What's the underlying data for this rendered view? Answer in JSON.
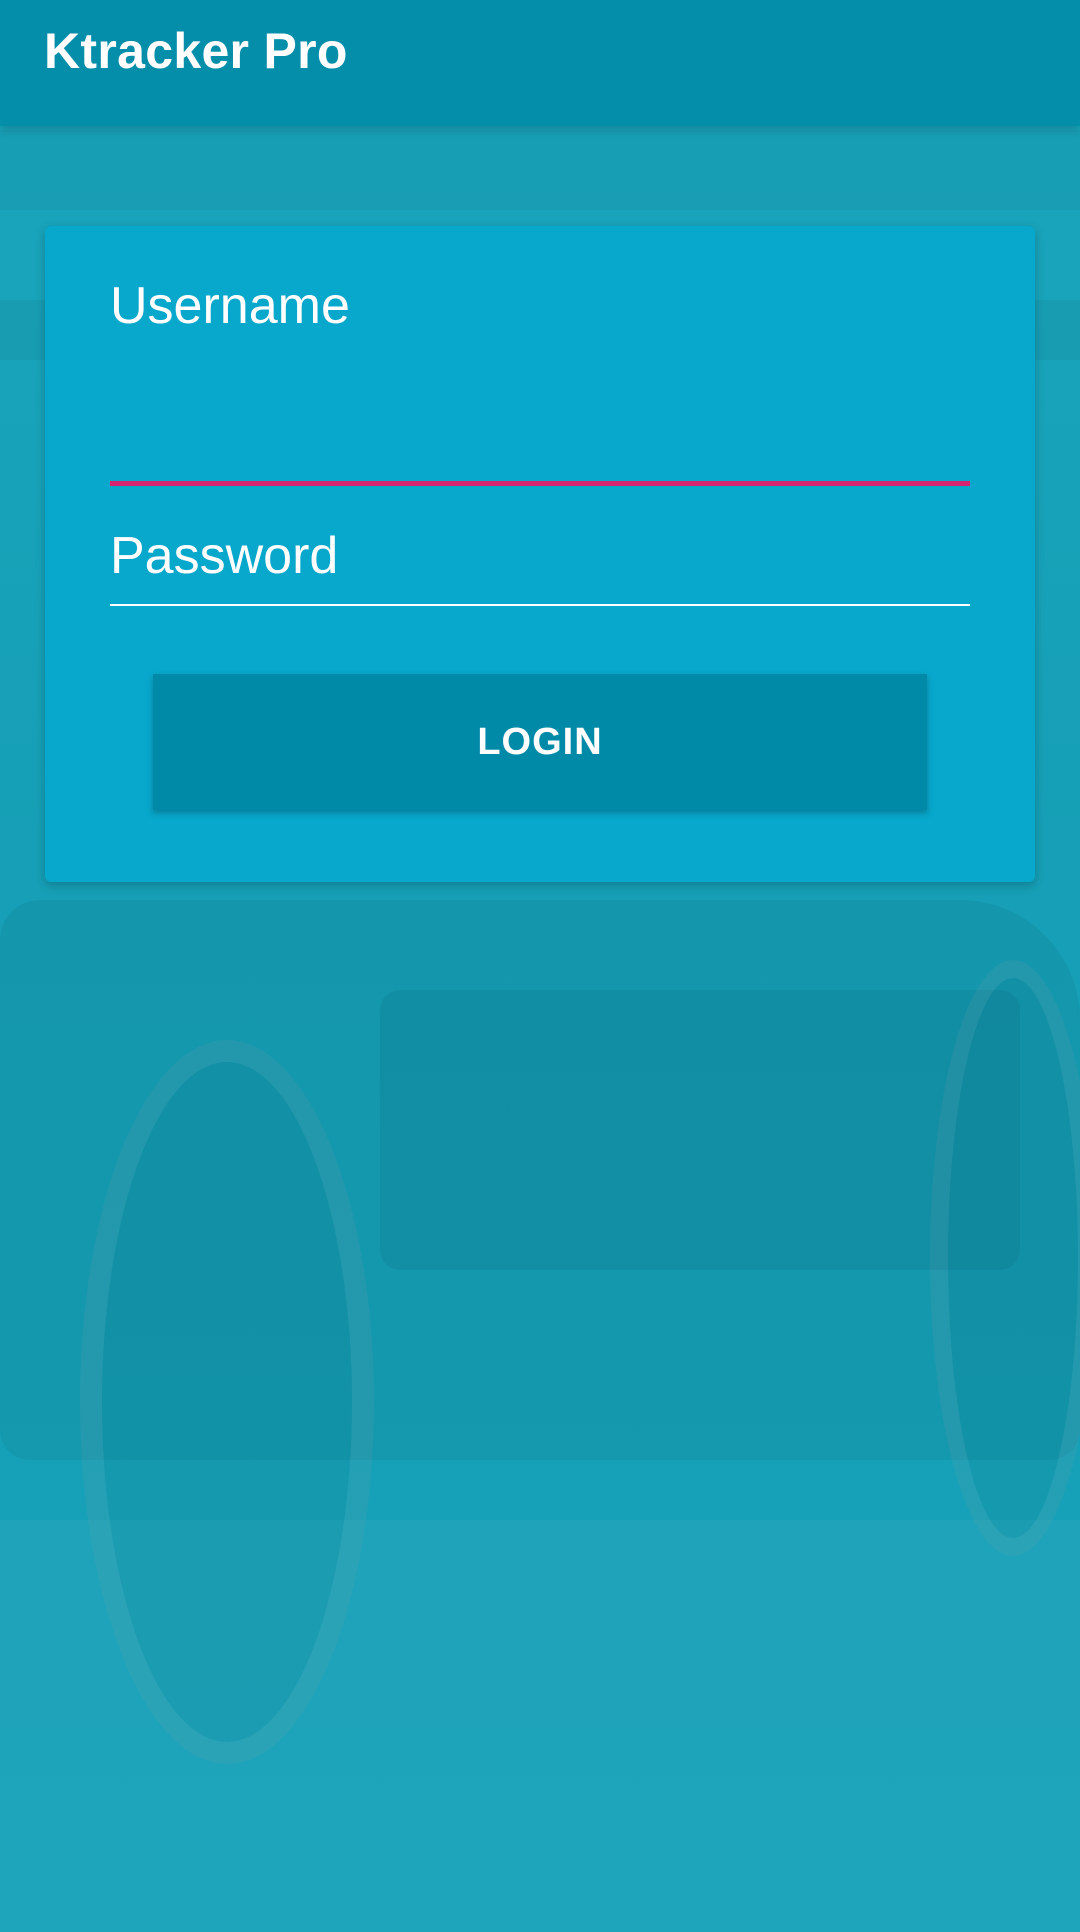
{
  "app_bar": {
    "title": "Ktracker Pro",
    "background_color": "#058ea9"
  },
  "login_form": {
    "username": {
      "label": "Username",
      "value": "",
      "underline_color": "#d6246e",
      "focused": true
    },
    "password": {
      "label": "Password",
      "value": "",
      "underline_color": "#ffffff",
      "focused": false
    },
    "login_button": {
      "label": "LOGIN",
      "color": "#018aa8"
    },
    "card_color": "#08a7cc"
  },
  "background": {
    "tint_color": "#18a3ba",
    "image_subject": "car"
  }
}
